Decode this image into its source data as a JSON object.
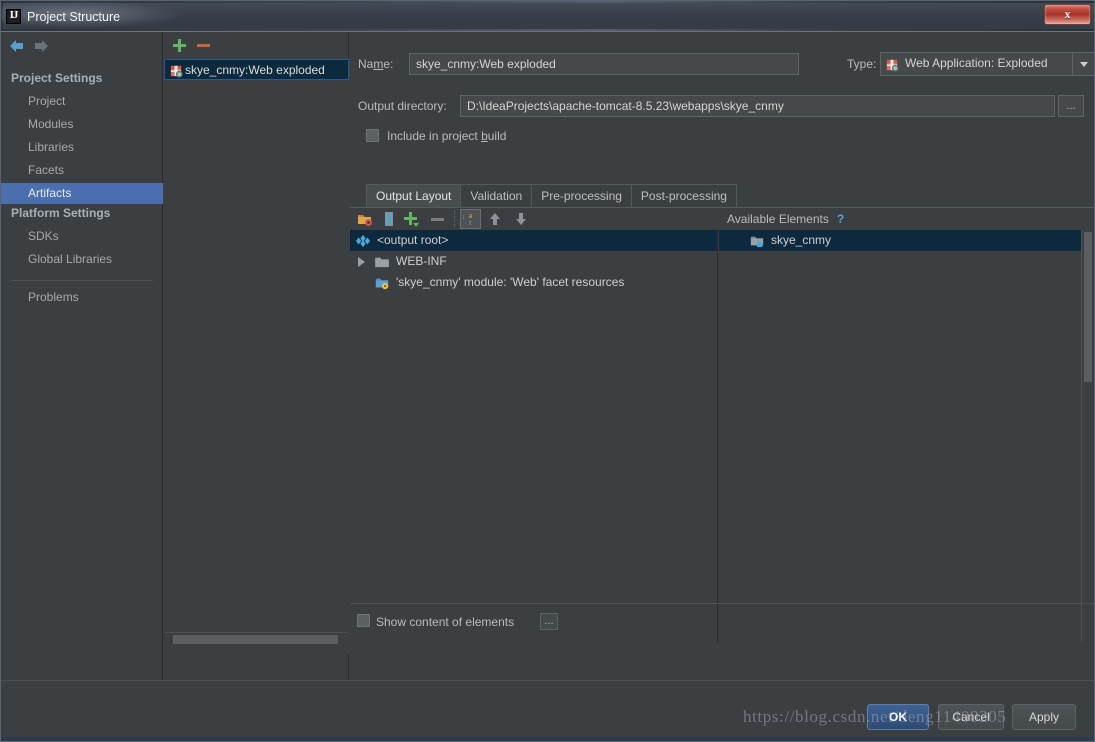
{
  "window": {
    "title": "Project Structure",
    "logo_text": "IJ",
    "close_label": "x"
  },
  "sidebar": {
    "back_icon": "back-arrow-icon",
    "forward_icon": "forward-arrow-icon",
    "groups": [
      {
        "label": "Project Settings"
      },
      {
        "label": "Platform Settings"
      }
    ],
    "items": [
      {
        "label": "Project",
        "selected": false
      },
      {
        "label": "Modules",
        "selected": false
      },
      {
        "label": "Libraries",
        "selected": false
      },
      {
        "label": "Facets",
        "selected": false
      },
      {
        "label": "Artifacts",
        "selected": true
      },
      {
        "label": "SDKs",
        "selected": false
      },
      {
        "label": "Global Libraries",
        "selected": false
      },
      {
        "label": "Problems",
        "selected": false
      }
    ],
    "help_label": "?"
  },
  "artifacts_panel": {
    "add_icon": "plus-icon",
    "remove_icon": "minus-icon",
    "items": [
      {
        "label": "skye_cnmy:Web exploded",
        "icon": "artifact-icon",
        "selected": true
      }
    ]
  },
  "detail": {
    "name_label": "Name:",
    "name_label_pre": "Na",
    "name_label_mnemonic": "m",
    "name_label_post": "e:",
    "name_value": "skye_cnmy:Web exploded",
    "type_label": "Type:",
    "type_value": "Web Application: Exploded",
    "type_icon": "web-application-icon",
    "output_dir_label": "Output directory:",
    "output_dir_value": "D:\\IdeaProjects\\apache-tomcat-8.5.23\\webapps\\skye_cnmy",
    "browse_label": "...",
    "include_checkbox": {
      "label_pre": "Include in project ",
      "label_mnemonic": "b",
      "label_post": "uild",
      "checked": false
    },
    "tabs": [
      {
        "label": "Output Layout",
        "active": true
      },
      {
        "label": "Validation",
        "active": false
      },
      {
        "label": "Pre-processing",
        "active": false
      },
      {
        "label": "Post-processing",
        "active": false
      }
    ],
    "toolbar_icons": [
      {
        "name": "add-copy-of-icon"
      },
      {
        "name": "add-archive-icon"
      },
      {
        "name": "add-element-icon"
      },
      {
        "name": "remove-element-icon"
      },
      {
        "name": "sort-alphabetically-icon"
      },
      {
        "name": "move-up-icon"
      },
      {
        "name": "move-down-icon"
      }
    ],
    "output_tree": [
      {
        "label": "<output root>",
        "icon": "output-root-icon",
        "depth": 0,
        "selected": true,
        "expandable": false
      },
      {
        "label": "WEB-INF",
        "icon": "folder-icon",
        "depth": 1,
        "selected": false,
        "expandable": true
      },
      {
        "label": "'skye_cnmy' module: 'Web' facet resources",
        "icon": "facet-resources-icon",
        "depth": 1,
        "selected": false,
        "expandable": false
      }
    ],
    "available_elements": {
      "title": "Available Elements",
      "help_label": "?",
      "items": [
        {
          "label": "skye_cnmy",
          "icon": "module-folder-icon",
          "selected": true
        }
      ]
    },
    "show_content_checkbox": {
      "label": "Show content of elements",
      "checked": false
    },
    "show_content_ellipsis": "..."
  },
  "buttons": {
    "ok": "OK",
    "cancel": "Cancel",
    "apply": "Apply"
  },
  "watermark": "https://blog.csdn.net/deng11408205",
  "colors": {
    "background": "#3c3f41",
    "selection_blue": "#4b6eaf",
    "tree_selection": "#0d293e",
    "accent_link": "#4fa6d8",
    "add_green": "#63b463",
    "remove_orange": "#c8643f"
  }
}
